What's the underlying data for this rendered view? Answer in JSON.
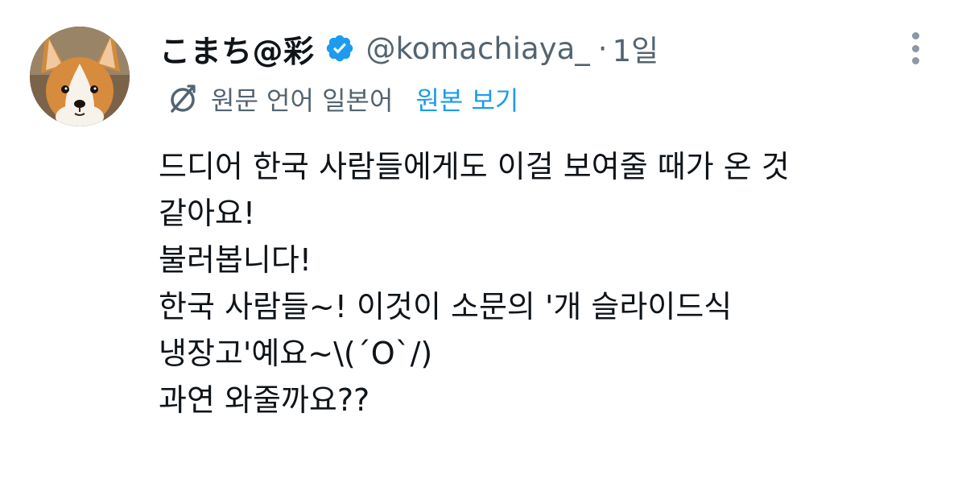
{
  "tweet": {
    "display_name": "こまち@彩",
    "handle": "@komachiaya_",
    "separator": "·",
    "time": "1일",
    "verified_icon": "verified-badge-icon",
    "more_icon": "more-vertical-icon",
    "avatar_description_icon": "avatar",
    "translation": {
      "icon": "translate-icon",
      "original_language_label": "원문 언어 일본어",
      "view_original_label": "원본 보기"
    },
    "lines": [
      "드디어 한국 사람들에게도 이걸 보여줄 때가 온 것",
      "같아요!",
      "불러봅니다!",
      "한국 사람들~! 이것이 소문의 '개 슬라이드식",
      "냉장고'예요~\\(´O`/)",
      "과연 와줄까요??"
    ]
  },
  "colors": {
    "primary_text": "#0f1419",
    "secondary_text": "#536471",
    "accent": "#1d9bf0",
    "verified": "#1d9bf0",
    "background": "#ffffff"
  }
}
